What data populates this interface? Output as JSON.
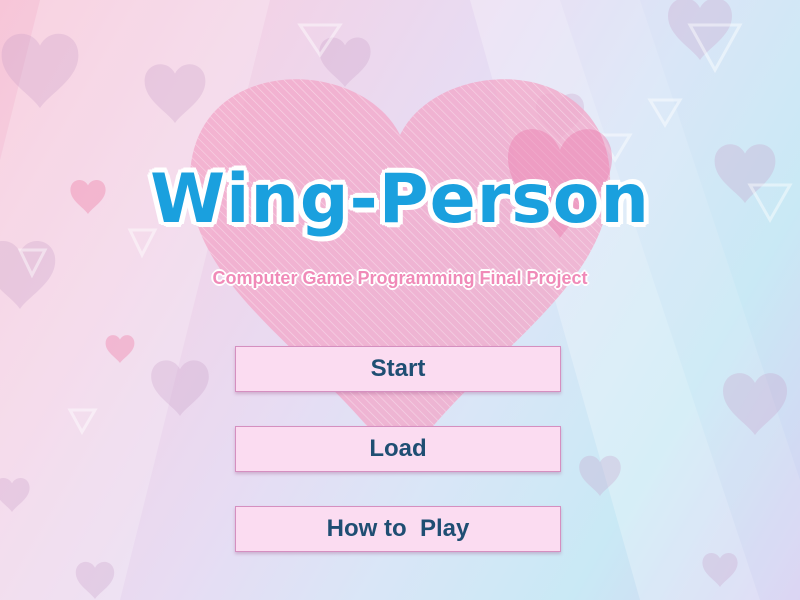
{
  "game": {
    "title": "Wing-Person",
    "subtitle": "Computer Game Programming Final Project"
  },
  "menu": {
    "items": [
      {
        "label": "Start"
      },
      {
        "label": "Load"
      },
      {
        "label": "How to  Play"
      }
    ]
  },
  "colors": {
    "title": "#1aa0de",
    "subtitle": "#f08ab8",
    "button_fill": "#fbdcf1",
    "button_border": "#d58fc0",
    "button_text": "#1f4e73",
    "big_heart": "#f2a8c9"
  }
}
